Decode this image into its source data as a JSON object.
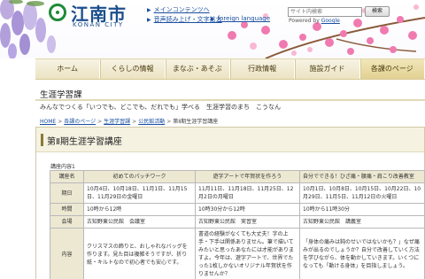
{
  "header": {
    "logo_text": "江南市",
    "logo_sub": "KONAN CITY",
    "links": {
      "main_content": "メインコンテンツへ",
      "accessibility": "音声読み上げ・文字拡大",
      "foreign_language": "foreign language"
    },
    "search": {
      "placeholder": "サイト内検索",
      "button": "検索",
      "powered_prefix": "Powered by",
      "powered_brand": "Google"
    }
  },
  "nav": {
    "items": [
      "ホーム",
      "くらしの情報",
      "まなぶ・あそぶ",
      "行政情報",
      "施設ガイド",
      "各課のページ"
    ],
    "active": "各課のページ"
  },
  "section": {
    "title": "生涯学習課",
    "tagline": "みんなでつくる「いつでも、どこでも、だれでも」学べる　生涯学習のまち　こうなん"
  },
  "breadcrumb": [
    "HOME",
    "各課のページ",
    "生涯学習課",
    "公民館活動",
    "第Ⅱ期生涯学習講座"
  ],
  "page_title": "第Ⅱ期生涯学習講座",
  "table": {
    "caption": "講座内容1",
    "headers": [
      "講座名",
      "初めてのパッチワーク",
      "遊字アートで年賀状を作ろう",
      "自分でできる！ひざ痛・腰痛・肩こり改善教室"
    ],
    "rows": [
      {
        "label": "期日",
        "cells": [
          "10月4日、10月18日、11月1日、11月15日、11月29日の金曜日",
          "11月11日、11月18日、11月25日、12月2日の月曜日",
          "10月1日、10月8日、10月15日、10月22日、10月29日、11月5日、11月12日の火曜日"
        ]
      },
      {
        "label": "時間",
        "cells": [
          "10時から12時",
          "10時30分から12時",
          "10時から11時30分"
        ]
      },
      {
        "label": "会場",
        "cells": [
          "古知野東公民館　会議室",
          "古知野東公民館　実習室",
          "古知野東公民館　講義室"
        ]
      },
      {
        "label": "内容",
        "cells": [
          "クリスマスの飾りと、おしゃれなバッグを作ります。見た目は複雑そうですが、折り紙・キルトなので初心者でも安心です。",
          "書道の経験がなくても大丈夫！字の上手・下手は関係ありません。筆で描いてみたいと思ったあなたには才能がありますよ。今年は、遊字アートで、世界でたった1枚しかないオリジナル年賀状を作りませんか？",
          "「身体の痛みは鈍のせいではないかも？」なぜ痛みが出るのでしょうか？自分で改善していく方法を学びながら、体を動かしていきます。いくつになっても「動ける身体」を目指しましょう。"
        ]
      }
    ]
  },
  "colors": {
    "nav_bg": "#ece3c3",
    "link": "#1a4fa0",
    "logo": "#1b4f8c",
    "table_header_bg": "#ece8d2",
    "sakura": "#f07ab0"
  }
}
